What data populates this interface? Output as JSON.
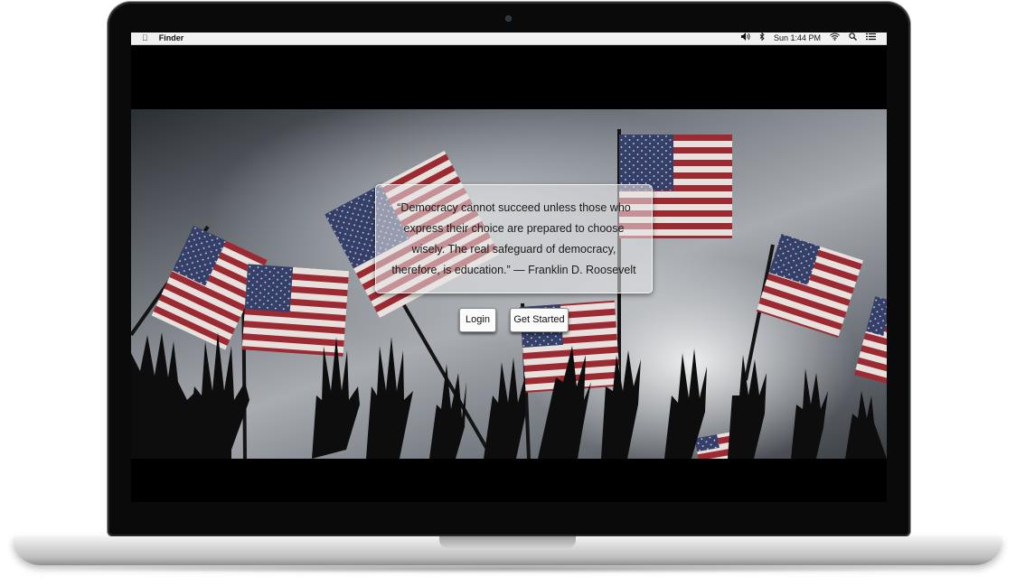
{
  "menubar": {
    "apple_icon": "apple-icon",
    "app_name": "Finder",
    "clock": "Sun 1:44 PM",
    "status_icons": [
      "volume-icon",
      "bluetooth-icon",
      "wifi-icon",
      "spotlight-icon",
      "menu-list-icon"
    ]
  },
  "hero": {
    "quote": "“Democracy cannot succeed unless those who express their choice are prepared to choose wisely. The real safeguard of democracy, therefore, is education.” — Franklin D. Roosevelt",
    "login_label": "Login",
    "get_started_label": "Get Started"
  },
  "colors": {
    "flag_red": "#9c2a33",
    "flag_blue": "#35406a",
    "screen_bg": "#000000",
    "menubar_bg": "#f1f1f1"
  }
}
